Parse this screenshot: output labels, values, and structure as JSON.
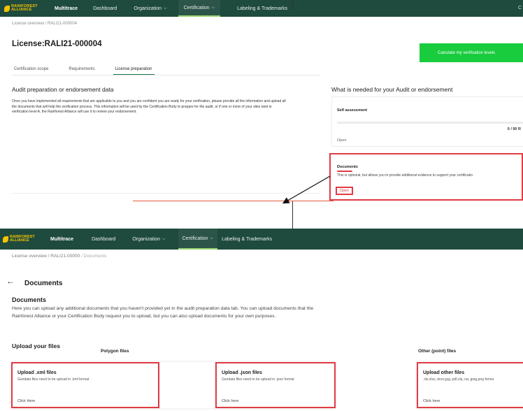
{
  "top": {
    "nav": {
      "logo": "RAINFOREST ALLIANCE",
      "brand": "Multitrace",
      "items": [
        "Dashboard",
        "Organization",
        "Certification",
        "Labeling & Trademarks"
      ],
      "right_letter": "C"
    },
    "breadcrumb": "License overview / RALI21-000004",
    "title": "License:RALI21-000004",
    "calc_button": "Calculate my verification levels",
    "tabs": [
      "Certification scope",
      "Requirements",
      "License preparation"
    ],
    "audit_heading": "Audit preparation or endorsement data",
    "audit_text": "Once you have implemented all requirements that are applicable to you and you are confident you are ready for your verification, please provide all the information and upload all the documents that will help the verification process. This information will be used by the Certification Body to prepare for the audit, or if one or more of your sites land in verification level A, the Rainforest Alliance will use it to review your endorsement.",
    "need_heading": "What is needed for your Audit or endorsement",
    "self_assessment": {
      "title": "Self assessment",
      "count": "0 / 90 R",
      "open": "Open"
    },
    "documents": {
      "title": "Documents",
      "desc": "This is optional, but allows you to provide additional evidence to support your certificatio",
      "open": "Open"
    }
  },
  "bottom": {
    "nav": {
      "logo": "RAINFOREST ALLIANCE",
      "brand": "Multitrace",
      "items": [
        "Dashboard",
        "Organization",
        "Certification",
        "Labeling & Trademarks"
      ]
    },
    "breadcrumb": "License overview / RALI21-00000",
    "breadcrumb_tail": "/ Documents",
    "title": "Documents",
    "docs_heading": "Documents",
    "docs_text": "Here you can upload any additional documents that you haven't provided yet in the audit preparation data tab. You can upload documents that the Rainforest Alliance or your Certification Body request you to upload, but you can also upload documents for your own purposes.",
    "upload_heading": "Upload your files",
    "polygon_label": "Polygon files",
    "other_label": "Other (point) files",
    "cards": [
      {
        "title": "Upload .xml files",
        "desc": "Geodata files need to be upload in .kml format",
        "cta": "Click Here"
      },
      {
        "title": "Upload .json files",
        "desc": "Geodata files need to be upload in .json format",
        "cta": "Click here"
      },
      {
        "title": "Upload other files",
        "desc": ".xls,xlsx,.docx,jpg,.pdf,zip,.rar,.jpeg,png forma",
        "cta": "Click here"
      }
    ]
  },
  "colors": {
    "nav_bg": "#1f4a3e",
    "accent_green": "#19cc3e",
    "highlight_red": "#e13b45",
    "logo_yellow": "#f2c300"
  }
}
